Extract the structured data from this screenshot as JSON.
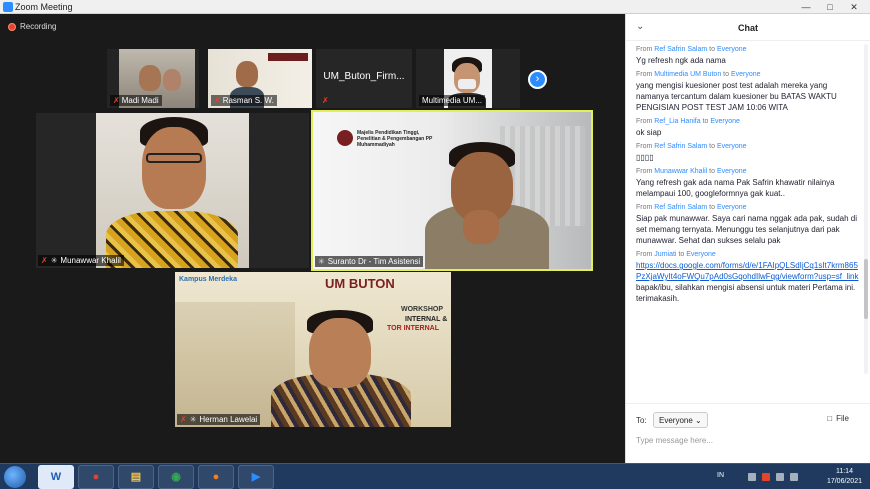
{
  "window": {
    "title": "Zoom Meeting"
  },
  "recording": {
    "label": "Recording"
  },
  "thumbnails": [
    {
      "name": "Madi Madi"
    },
    {
      "name": "Rasman S. W."
    },
    {
      "name": "UM_Buton_Firm...",
      "label": "UM_Buton_Firm..."
    },
    {
      "name": "Multimedia UM..."
    }
  ],
  "tiles": {
    "munawwar": {
      "name": "Munawwar Khalil"
    },
    "suranto": {
      "name": "Suranto Dr - Tim Asistensi",
      "slide_text": "Majelis Pendidikan Tinggi, Penelitian & Pengembangan PP Muhammadiyah"
    },
    "herman": {
      "name": "Herman Lawelai",
      "bg_brand": "UM BUTON",
      "bg_line1": "WORKSHOP",
      "bg_line2": "INTERNAL &",
      "bg_line3": "TOR INTERNAL",
      "bg_logo": "Kampus Merdeka"
    }
  },
  "chat": {
    "title": "Chat",
    "messages": [
      {
        "from": "Ref Safrin Salam",
        "to": "Everyone",
        "text": "Yg refresh ngk ada nama"
      },
      {
        "from": "Multimedia UM Buton",
        "to": "Everyone",
        "text": "yang mengisi kuesioner post test adalah mereka yang namanya tercantum dalam kuesioner bu BATAS WAKTU PENGISIAN POST TEST JAM 10:06 WITA"
      },
      {
        "from": "Ref_Lia Hanifa",
        "to": "Everyone",
        "text": "ok siap"
      },
      {
        "from": "Ref Safrin Salam",
        "to": "Everyone",
        "text": "▯▯▯▯"
      },
      {
        "from": "Munawwar Khalil",
        "to": "Everyone",
        "text": "Yang refresh gak ada nama Pak Safrin khawatir nilainya melampaui 100, googleformnya gak kuat.."
      },
      {
        "from": "Ref Safrin Salam",
        "to": "Everyone",
        "text": "Siap pak munawwar. Saya cari nama nggak ada pak, sudah di set memang ternyata. Menunggu tes selanjutnya dari pak munawwar. Sehat dan sukses selalu pak"
      },
      {
        "from": "Jumiati",
        "to": "Everyone",
        "link": "https://docs.google.com/forms/d/e/1FAIpQLSdIjCq1sIt7krm865PzXjaWyIt4oFWQu7pAd0sGqohdIlwFqg/viewform?usp=sf_link",
        "text": "bapak/ibu, silahkan mengisi absensi untuk materi Pertama ini. terimakasih."
      }
    ],
    "from_label": "From",
    "to_word": "to",
    "to_label": "To:",
    "to_value": "Everyone",
    "file_label": "File",
    "input_placeholder": "Type message here..."
  },
  "taskbar": {
    "lang": "IN",
    "time": "11:14",
    "date": "17/06/2021"
  }
}
